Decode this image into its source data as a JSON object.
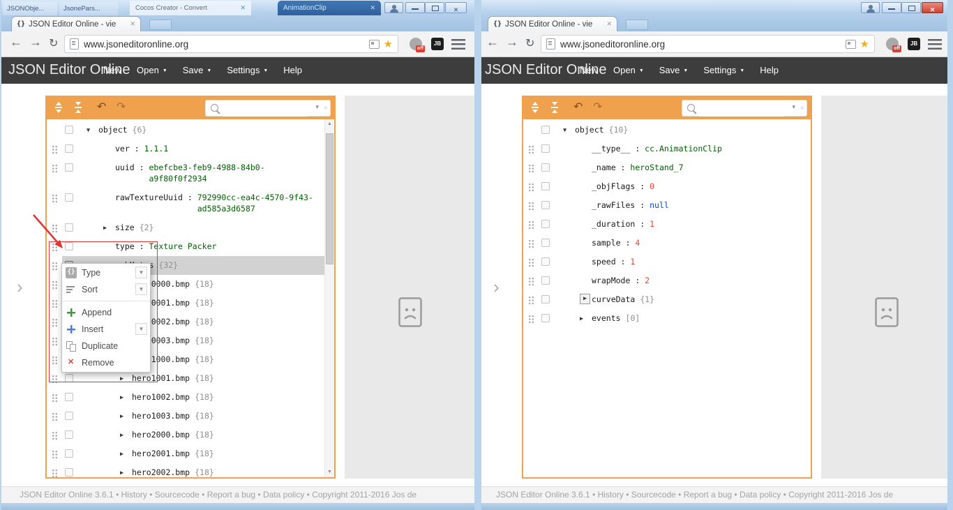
{
  "icons": {
    "favicon": "{}",
    "close": "✕",
    "back": "←",
    "forward": "→",
    "reload": "↻",
    "undo": "↶",
    "redo": "↷",
    "star": "★",
    "chevron": "›",
    "tri_down": "▼",
    "tri_right": "▶",
    "scroll_up": "▲",
    "scroll_down": "▼",
    "search_next": "▾",
    "search_prev": "▵"
  },
  "ui": {
    "tab_title": "JSON Editor Online - vie",
    "url": "www.jsoneditoronline.org",
    "app_title": "JSON Editor Online",
    "menu": [
      {
        "label": "New",
        "arrow": false
      },
      {
        "label": "Open",
        "arrow": true
      },
      {
        "label": "Save",
        "arrow": true
      },
      {
        "label": "Settings",
        "arrow": true
      },
      {
        "label": "Help",
        "arrow": false
      }
    ],
    "search_value": "",
    "ext_badge": "off",
    "ext_label": "JB",
    "footer": "JSON Editor Online 3.6.1 • History • Sourcecode • Report a bug • Data policy • Copyright 2011-2016 Jos de"
  },
  "background_windows": {
    "tab1": "JSONObje...",
    "tab2": "JsonePars...",
    "window_title": "Cocos Creator - Convert",
    "dark_tab": "AnimationClip"
  },
  "left_tree": {
    "rows": [
      {
        "square": true,
        "level": 0,
        "expander": "down",
        "field": "object",
        "count": "{6}"
      },
      {
        "handle": true,
        "square": true,
        "level": 1,
        "field": "ver",
        "value": "1.1.1",
        "vtype": "string"
      },
      {
        "handle": true,
        "square": true,
        "level": 1,
        "field": "uuid",
        "value": "ebefcbe3-feb9-4988-84b0-a9f80f0f2934",
        "vtype": "string"
      },
      {
        "handle": true,
        "square": true,
        "level": 1,
        "field": "rawTextureUuid",
        "value": "792990cc-ea4c-4570-9f43-ad585a3d6587",
        "vtype": "string"
      },
      {
        "handle": true,
        "square": true,
        "level": 1,
        "expander": "right",
        "field": "size",
        "count": "{2}"
      },
      {
        "handle": true,
        "square": true,
        "level": 1,
        "field": "type",
        "value": "Texture Packer",
        "vtype": "string"
      },
      {
        "handle": true,
        "square": "active",
        "level": 1,
        "expander": "down",
        "field": "subMetas",
        "count": "{32}",
        "selected": true
      },
      {
        "handle": true,
        "square": true,
        "level": 2,
        "expander": "right",
        "field": "hero0000.bmp",
        "count": "{18}"
      },
      {
        "handle": true,
        "square": true,
        "level": 2,
        "expander": "right",
        "field": "hero0001.bmp",
        "count": "{18}"
      },
      {
        "handle": true,
        "square": true,
        "level": 2,
        "expander": "right",
        "field": "hero0002.bmp",
        "count": "{18}"
      },
      {
        "handle": true,
        "square": true,
        "level": 2,
        "expander": "right",
        "field": "hero0003.bmp",
        "count": "{18}"
      },
      {
        "handle": true,
        "square": true,
        "level": 2,
        "expander": "right",
        "field": "hero1000.bmp",
        "count": "{18}"
      },
      {
        "handle": true,
        "square": true,
        "level": 2,
        "expander": "right",
        "field": "hero1001.bmp",
        "count": "{18}"
      },
      {
        "handle": true,
        "square": true,
        "level": 2,
        "expander": "right",
        "field": "hero1002.bmp",
        "count": "{18}"
      },
      {
        "handle": true,
        "square": true,
        "level": 2,
        "expander": "right",
        "field": "hero1003.bmp",
        "count": "{18}"
      },
      {
        "handle": true,
        "square": true,
        "level": 2,
        "expander": "right",
        "field": "hero2000.bmp",
        "count": "{18}"
      },
      {
        "handle": true,
        "square": true,
        "level": 2,
        "expander": "right",
        "field": "hero2001.bmp",
        "count": "{18}"
      },
      {
        "handle": true,
        "square": true,
        "level": 2,
        "expander": "right",
        "field": "hero2002.bmp",
        "count": "{18}"
      }
    ]
  },
  "right_tree": {
    "rows": [
      {
        "square": true,
        "level": 0,
        "expander": "down",
        "field": "object",
        "count": "{10}"
      },
      {
        "handle": true,
        "square": true,
        "level": 1,
        "field": "__type__",
        "value": "cc.AnimationClip",
        "vtype": "string"
      },
      {
        "handle": true,
        "square": true,
        "level": 1,
        "field": "_name",
        "value": "heroStand_7",
        "vtype": "string"
      },
      {
        "handle": true,
        "square": true,
        "level": 1,
        "field": "_objFlags",
        "value": "0",
        "vtype": "number"
      },
      {
        "handle": true,
        "square": true,
        "level": 1,
        "field": "_rawFiles",
        "value": "null",
        "vtype": "null"
      },
      {
        "handle": true,
        "square": true,
        "level": 1,
        "field": "_duration",
        "value": "1",
        "vtype": "number"
      },
      {
        "handle": true,
        "square": true,
        "level": 1,
        "field": "sample",
        "value": "4",
        "vtype": "number"
      },
      {
        "handle": true,
        "square": true,
        "level": 1,
        "field": "speed",
        "value": "1",
        "vtype": "number"
      },
      {
        "handle": true,
        "square": true,
        "level": 1,
        "field": "wrapMode",
        "value": "2",
        "vtype": "number"
      },
      {
        "handle": true,
        "square": true,
        "level": 1,
        "expander": "right",
        "boxed": true,
        "field": "curveData",
        "count": "{1}"
      },
      {
        "handle": true,
        "square": true,
        "level": 1,
        "expander": "right",
        "field": "events",
        "count": "[0]"
      }
    ]
  },
  "context_menu": {
    "items": [
      {
        "label": "Type",
        "icon": "type-icon",
        "sub": true
      },
      {
        "label": "Sort",
        "icon": "sort-icon",
        "sub": true
      },
      {
        "sep": true
      },
      {
        "label": "Append",
        "icon": "append-icon"
      },
      {
        "label": "Insert",
        "icon": "insert-icon",
        "sub": true
      },
      {
        "label": "Duplicate",
        "icon": "duplicate-icon"
      },
      {
        "label": "Remove",
        "icon": "remove-icon"
      }
    ]
  },
  "colors": {
    "accent_orange": "#f0a14e",
    "header_dark": "#3d3d3d",
    "string_value": "#006000",
    "number_value": "#ee422e",
    "null_value": "#004ed0",
    "selection_grey": "#d2d2d2",
    "annotation_red": "#e23333"
  }
}
